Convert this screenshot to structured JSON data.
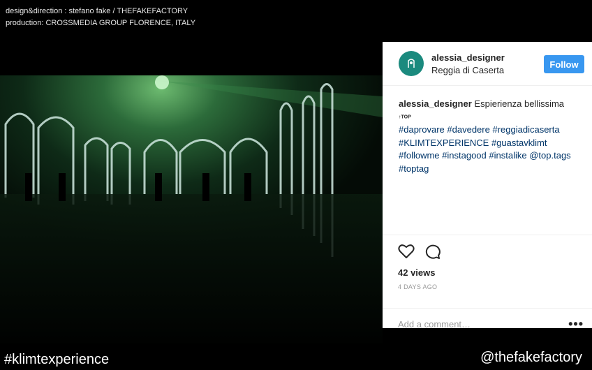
{
  "credits": {
    "line1": "design&direction : stefano fake / THEFAKEFACTORY",
    "line2": "production: CROSSMEDIA GROUP FLORENCE, ITALY"
  },
  "post": {
    "username": "alessia_designer",
    "location": "Reggia di Caserta",
    "follow_label": "Follow",
    "caption_user": "alessia_designer",
    "caption_text": "Espierienza bellissima",
    "top_emoji": "TOP",
    "hashtags": [
      "#daprovare",
      "#davedere",
      "#reggiadicaserta",
      "#KLIMTEXPERIENCE",
      "#guastavklimt",
      "#followme",
      "#instagood",
      "#instalike",
      "@top.tags",
      "#toptag"
    ],
    "views": "42 views",
    "date": "4 DAYS AGO",
    "comment_placeholder": "Add a comment…",
    "more": "•••"
  },
  "footer": {
    "left": "#klimtexperience",
    "right": "@thefakefactory"
  },
  "icons": {
    "heart": "heart-icon",
    "comment": "comment-icon",
    "more": "more-options-icon"
  },
  "colors": {
    "follow": "#3897f0",
    "hashtag": "#003569",
    "avatar": "#1b8a7e",
    "video_green": "#1e5a2c"
  }
}
